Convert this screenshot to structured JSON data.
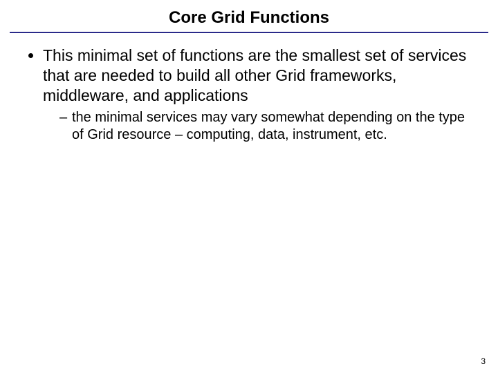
{
  "slide": {
    "title": "Core Grid Functions",
    "bullets": [
      {
        "text": "This minimal set of functions are the smallest set of services that are needed to build all other Grid frameworks, middleware, and applications",
        "sub": [
          "the minimal services may vary somewhat depending on the type of Grid resource – computing, data, instrument, etc."
        ]
      }
    ],
    "page_number": "3"
  }
}
